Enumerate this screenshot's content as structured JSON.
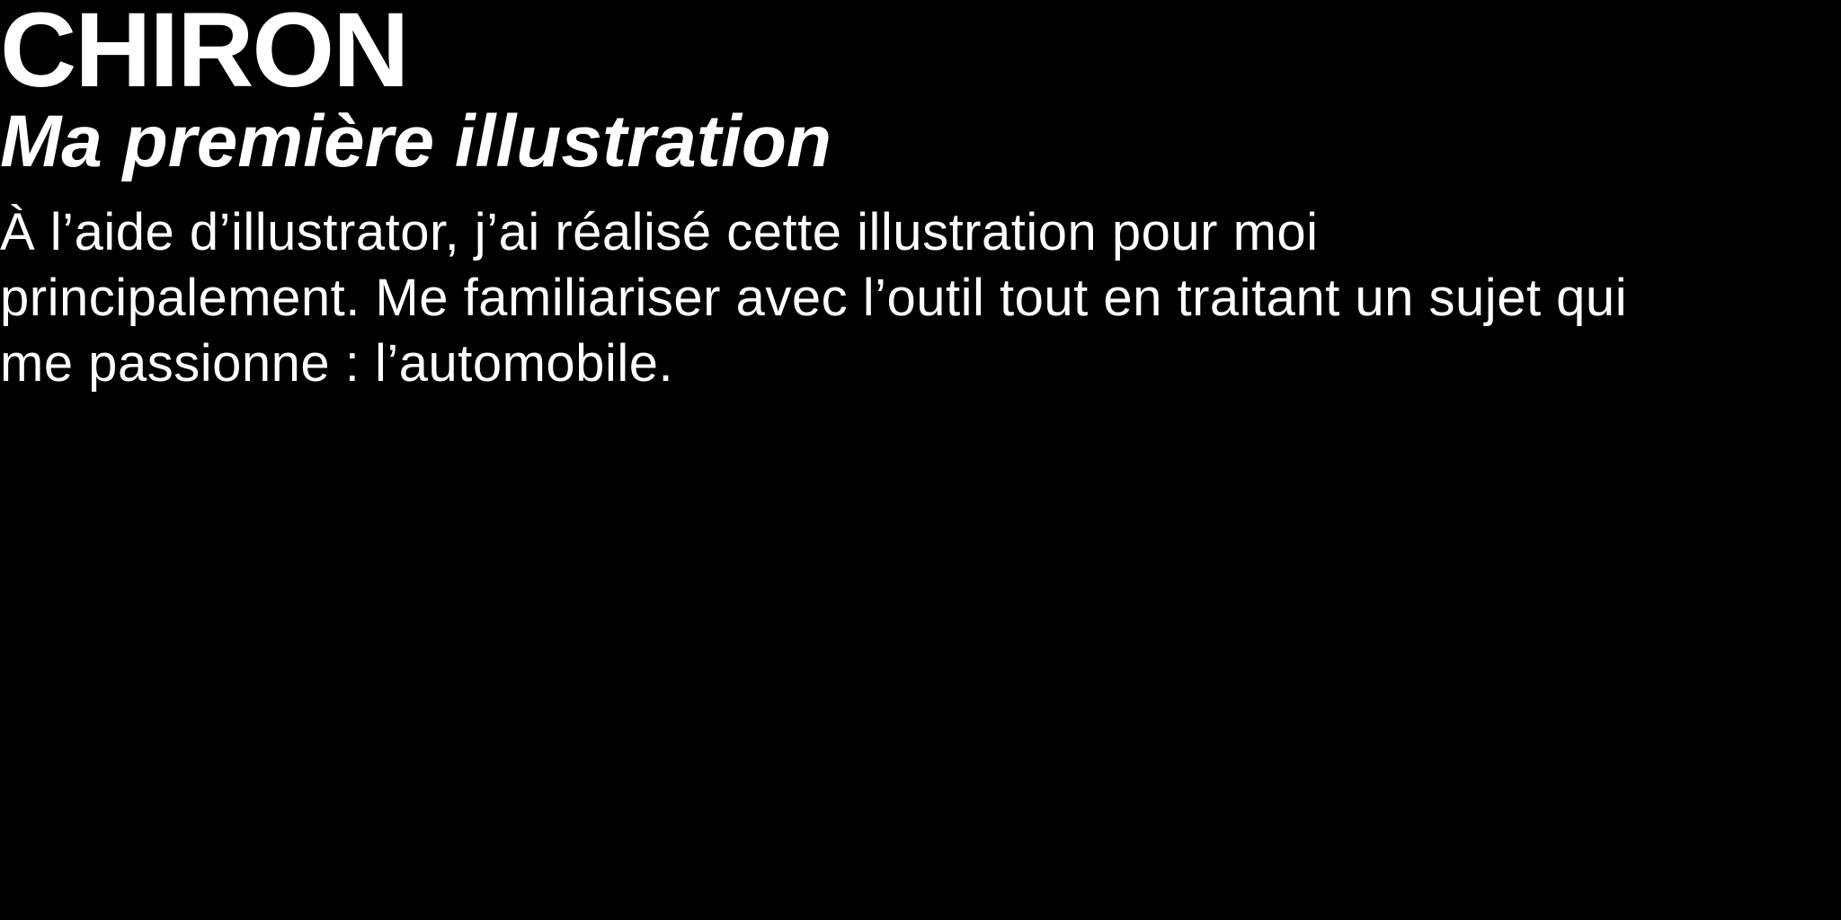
{
  "header": {
    "title": "CHIRON",
    "subtitle": "Ma première illustration"
  },
  "main": {
    "description": "À l’aide d’illustrator, j’ai réalisé cette illustration pour moi principalement. Me familiariser avec l’outil tout en traitant un sujet qui me passionne : l’automobile."
  },
  "colors": {
    "background": "#000000",
    "text": "#ffffff"
  }
}
